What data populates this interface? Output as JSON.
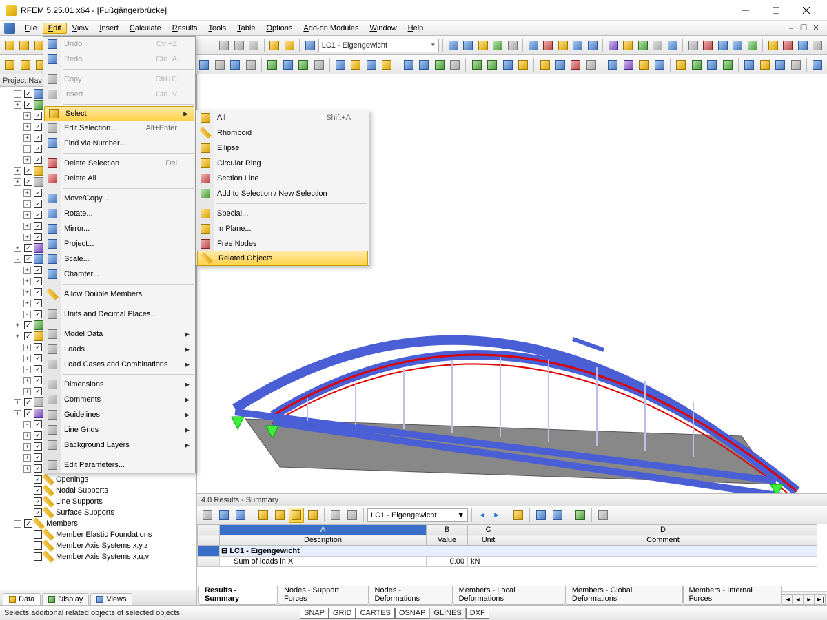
{
  "window": {
    "title": "RFEM 5.25.01 x64 - [Fußgängerbrücke]"
  },
  "menubar": [
    "File",
    "Edit",
    "View",
    "Insert",
    "Calculate",
    "Results",
    "Tools",
    "Table",
    "Options",
    "Add-on Modules",
    "Window",
    "Help"
  ],
  "menubar_open_index": 1,
  "loadcase_combo": "LC1 - Eigengewicht",
  "edit_menu": [
    {
      "label": "Undo",
      "shortcut": "Ctrl+Z",
      "icon": "undo",
      "disabled": true
    },
    {
      "label": "Redo",
      "shortcut": "Ctrl+A",
      "icon": "redo",
      "disabled": true
    },
    {
      "sep": true
    },
    {
      "label": "Copy",
      "shortcut": "Ctrl+C",
      "icon": "copy",
      "disabled": true
    },
    {
      "label": "Insert",
      "shortcut": "Ctrl+V",
      "icon": "paste",
      "disabled": true
    },
    {
      "sep": true
    },
    {
      "label": "Select",
      "sub": true,
      "icon": "select",
      "hl": true
    },
    {
      "label": "Edit Selection...",
      "shortcut": "Alt+Enter",
      "icon": "edit"
    },
    {
      "label": "Find via Number...",
      "icon": "find"
    },
    {
      "sep": true
    },
    {
      "label": "Delete Selection",
      "shortcut": "Del",
      "icon": "delete"
    },
    {
      "label": "Delete All",
      "icon": "delete-all"
    },
    {
      "sep": true
    },
    {
      "label": "Move/Copy...",
      "icon": "move"
    },
    {
      "label": "Rotate...",
      "icon": "rotate"
    },
    {
      "label": "Mirror...",
      "icon": "mirror"
    },
    {
      "label": "Project...",
      "icon": "project"
    },
    {
      "label": "Scale...",
      "icon": "scale"
    },
    {
      "label": "Chamfer...",
      "icon": "chamfer"
    },
    {
      "sep": true
    },
    {
      "label": "Allow Double Members",
      "icon": "double"
    },
    {
      "sep": true
    },
    {
      "label": "Units and Decimal Places...",
      "icon": "units"
    },
    {
      "sep": true
    },
    {
      "label": "Model Data",
      "sub": true
    },
    {
      "label": "Loads",
      "sub": true
    },
    {
      "label": "Load Cases and Combinations",
      "sub": true
    },
    {
      "sep": true
    },
    {
      "label": "Dimensions",
      "sub": true
    },
    {
      "label": "Comments",
      "sub": true
    },
    {
      "label": "Guidelines",
      "sub": true
    },
    {
      "label": "Line Grids",
      "sub": true
    },
    {
      "label": "Background Layers",
      "sub": true
    },
    {
      "sep": true
    },
    {
      "label": "Edit Parameters...",
      "icon": "params"
    }
  ],
  "select_submenu": [
    {
      "label": "All",
      "shortcut": "Shift+A",
      "icon": "all"
    },
    {
      "label": "Rhomboid",
      "icon": "rhomboid"
    },
    {
      "label": "Ellipse",
      "icon": "ellipse"
    },
    {
      "label": "Circular Ring",
      "icon": "ring"
    },
    {
      "label": "Section Line",
      "icon": "section"
    },
    {
      "label": "Add to Selection / New Selection",
      "icon": "add"
    },
    {
      "sep": true
    },
    {
      "label": "Special...",
      "icon": "special"
    },
    {
      "label": "In Plane...",
      "icon": "plane"
    },
    {
      "label": "Free Nodes",
      "icon": "nodes"
    },
    {
      "label": "Related Objects",
      "icon": "related",
      "hl": true
    }
  ],
  "sidebar": {
    "title": "Project Nav",
    "tabs": [
      "Data",
      "Display",
      "Views"
    ],
    "active_tab": 0,
    "tree_tail": [
      {
        "label": "Openings",
        "checked": true,
        "ind": 2
      },
      {
        "label": "Nodal Supports",
        "checked": true,
        "ind": 2
      },
      {
        "label": "Line Supports",
        "checked": true,
        "ind": 2
      },
      {
        "label": "Surface Supports",
        "checked": true,
        "ind": 2
      },
      {
        "label": "Members",
        "checked": true,
        "ind": 1,
        "exp": "-"
      },
      {
        "label": "Member Elastic Foundations",
        "checked": false,
        "ind": 2
      },
      {
        "label": "Member Axis Systems x,y,z",
        "checked": false,
        "ind": 2
      },
      {
        "label": "Member Axis Systems x,u,v",
        "checked": false,
        "ind": 2
      }
    ]
  },
  "results": {
    "title": "4.0 Results - Summary",
    "combo": "LC1 - Eigengewicht",
    "columns": {
      "A": "Description",
      "B": "Value",
      "C": "Unit",
      "D": "Comment"
    },
    "group": "LC1 - Eigengewicht",
    "row1": {
      "desc": "Sum of loads in X",
      "value": "0.00",
      "unit": "kN",
      "comment": ""
    },
    "tabs": [
      "Results - Summary",
      "Nodes - Support Forces",
      "Nodes - Deformations",
      "Members - Local Deformations",
      "Members - Global Deformations",
      "Members - Internal Forces"
    ],
    "active_tab": 0
  },
  "statusbar": {
    "hint": "Selects additional related objects of selected objects.",
    "toggles": [
      "SNAP",
      "GRID",
      "CARTES",
      "OSNAP",
      "GLINES",
      "DXF"
    ],
    "toggle_state": [
      true,
      true,
      true,
      true,
      false,
      true
    ]
  }
}
